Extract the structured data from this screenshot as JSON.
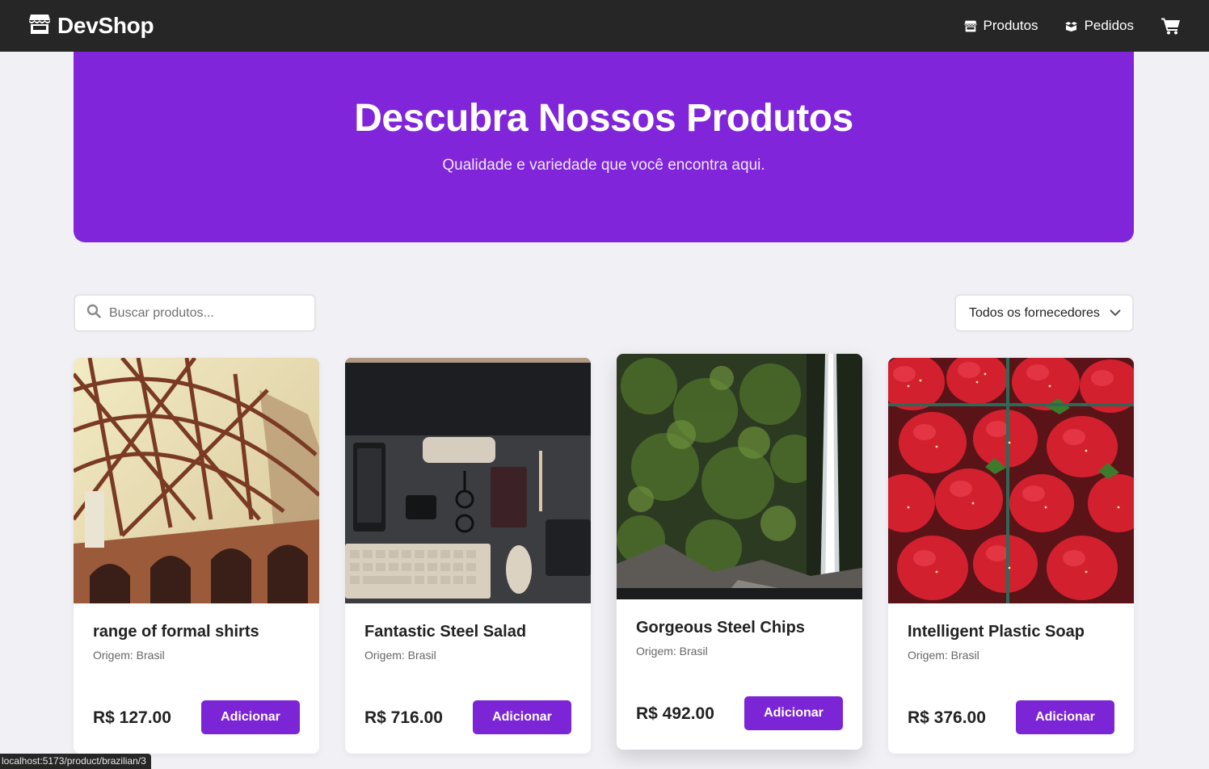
{
  "nav": {
    "brand": "DevShop",
    "links": [
      {
        "label": "Produtos",
        "icon": "store-icon"
      },
      {
        "label": "Pedidos",
        "icon": "box-icon"
      }
    ],
    "cart_icon": "cart-icon"
  },
  "hero": {
    "title": "Descubra Nossos Produtos",
    "subtitle": "Qualidade e variedade que você encontra aqui."
  },
  "filters": {
    "search_placeholder": "Buscar produtos...",
    "supplier_selected": "Todos os fornecedores"
  },
  "products": [
    {
      "name": "range of formal shirts",
      "origin": "Origem: Brasil",
      "price": "R$ 127.00",
      "button": "Adicionar",
      "image": "bridge-photo"
    },
    {
      "name": "Fantastic Steel Salad",
      "origin": "Origem: Brasil",
      "price": "R$ 716.00",
      "button": "Adicionar",
      "image": "desk-photo"
    },
    {
      "name": "Gorgeous Steel Chips",
      "origin": "Origem: Brasil",
      "price": "R$ 492.00",
      "button": "Adicionar",
      "image": "waterfall-photo"
    },
    {
      "name": "Intelligent Plastic Soap",
      "origin": "Origem: Brasil",
      "price": "R$ 376.00",
      "button": "Adicionar",
      "image": "strawberries-photo"
    }
  ],
  "status_bar": {
    "url": "localhost:5173/product/brazilian/3"
  },
  "colors": {
    "accent": "#8025d9",
    "button": "#7b25d6",
    "navbar": "#262626",
    "background": "#f0f0f5"
  }
}
